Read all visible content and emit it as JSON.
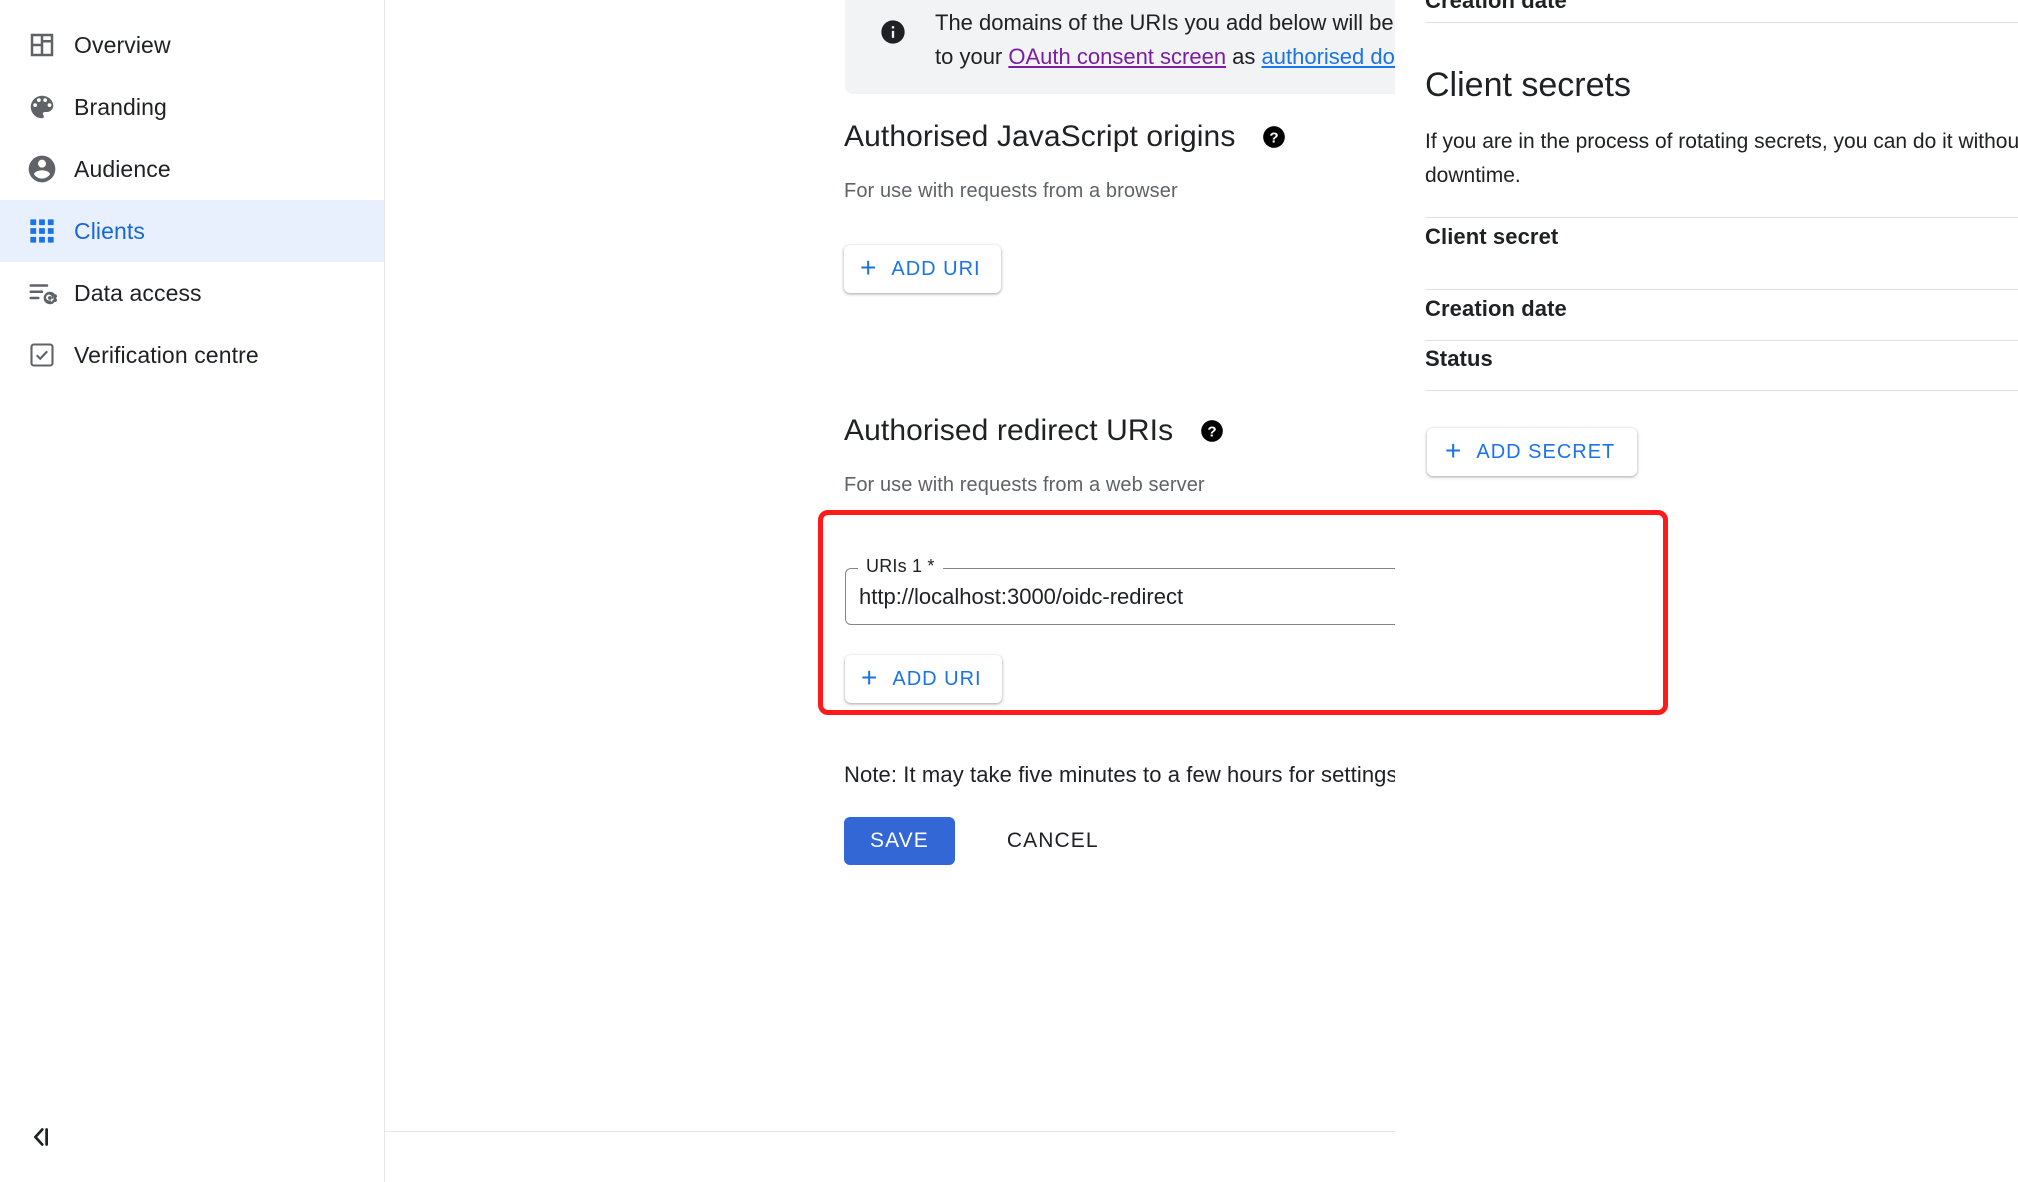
{
  "sidebar": {
    "items": [
      {
        "label": "Overview",
        "icon": "overview-icon",
        "active": false
      },
      {
        "label": "Branding",
        "icon": "palette-icon",
        "active": false
      },
      {
        "label": "Audience",
        "icon": "account-circle-icon",
        "active": false
      },
      {
        "label": "Clients",
        "icon": "apps-grid-icon",
        "active": true
      },
      {
        "label": "Data access",
        "icon": "data-access-icon",
        "active": false
      },
      {
        "label": "Verification centre",
        "icon": "check-box-icon",
        "active": false
      }
    ],
    "collapse_icon": "collapse-panel-icon"
  },
  "banner": {
    "icon": "info-icon",
    "text_part1": "The domains of the URIs you add below will be automatically added to your ",
    "link_consent": "OAuth consent screen",
    "text_part2": " as ",
    "link_domains": "authorised domains",
    "external_icon": "open-in-new-icon",
    "text_part3": "."
  },
  "origins_section": {
    "title": "Authorised JavaScript origins",
    "help_icon": "help-icon",
    "subtitle": "For use with requests from a browser",
    "add_button": "ADD URI",
    "add_icon": "plus-icon"
  },
  "redirect_section": {
    "title": "Authorised redirect URIs",
    "help_icon": "help-icon",
    "subtitle": "For use with requests from a web server",
    "uri_label": "URIs 1 *",
    "uri_value": "http://localhost:3000/oidc-redirect",
    "uri_placeholder": "",
    "add_button": "ADD URI",
    "add_icon": "plus-icon"
  },
  "footer": {
    "note": "Note: It may take five minutes to a few hours for settings to take effect",
    "save_label": "SAVE",
    "cancel_label": "CANCEL"
  },
  "right_panel": {
    "top_row_label": "Creation date",
    "title": "Client secrets",
    "description": "If you are in the process of rotating secrets, you can do it without downtime.",
    "rows": [
      {
        "label": "Client secret"
      },
      {
        "label": "Creation date"
      },
      {
        "label": "Status"
      }
    ],
    "add_secret_button": "ADD SECRET",
    "add_icon": "plus-icon"
  },
  "colors": {
    "accent_blue": "#1a73e8",
    "save_blue": "#3367d6",
    "active_nav_bg": "#e8f0fe",
    "visited_link_purple": "#7b1fa2",
    "banner_bg": "#f1f3f4",
    "highlight_red": "#ff1a1a",
    "muted_text": "#5f6368"
  }
}
